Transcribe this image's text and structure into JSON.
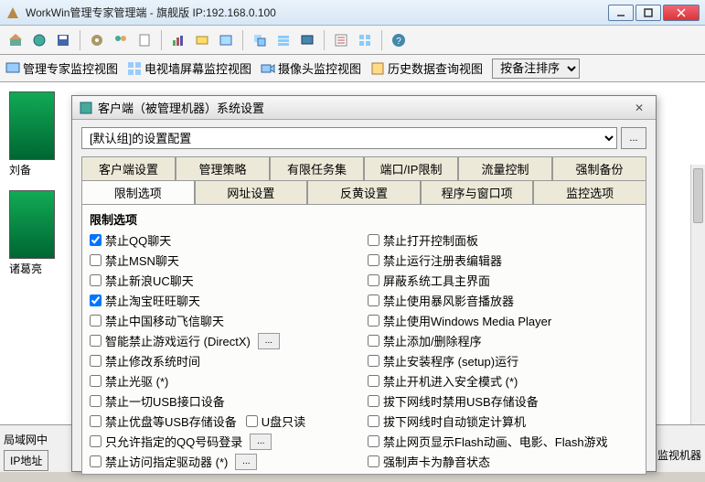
{
  "titlebar": {
    "app_title": "WorkWin管理专家管理端 - 旗舰版 IP:192.168.0.100"
  },
  "viewtabs": {
    "items": [
      "管理专家监控视图",
      "电视墙屏幕监控视图",
      "摄像头监控视图",
      "历史数据查询视图"
    ],
    "sort_label": "按备注排序"
  },
  "thumbs": [
    {
      "label": "刘备"
    },
    {
      "label": "诸葛亮"
    }
  ],
  "bottom": {
    "line1": "局域网中",
    "btn1": "IP地址",
    "right_label": "监视机器"
  },
  "dialog": {
    "title": "客户端（被管理机器）系统设置",
    "combo_value": "[默认组]的设置配置",
    "browse": "...",
    "tabs_row1": [
      "客户端设置",
      "管理策略",
      "有限任务集",
      "端口/IP限制",
      "流量控制",
      "强制备份"
    ],
    "tabs_row2": [
      "限制选项",
      "网址设置",
      "反黄设置",
      "程序与窗口项",
      "监控选项"
    ],
    "active_tab": "限制选项",
    "panel_title": "限制选项",
    "left_col": [
      {
        "label": "禁止QQ聊天",
        "checked": true
      },
      {
        "label": "禁止MSN聊天",
        "checked": false
      },
      {
        "label": "禁止新浪UC聊天",
        "checked": false
      },
      {
        "label": "禁止淘宝旺旺聊天",
        "checked": true
      },
      {
        "label": "禁止中国移动飞信聊天",
        "checked": false
      },
      {
        "label": "智能禁止游戏运行 (DirectX)",
        "checked": false,
        "aux": true
      },
      {
        "label": "禁止修改系统时间",
        "checked": false
      },
      {
        "label": "禁止光驱 (*)",
        "checked": false
      },
      {
        "label": "禁止一切USB接口设备",
        "checked": false
      },
      {
        "label": "禁止优盘等USB存储设备",
        "checked": false,
        "extra_label": "U盘只读",
        "extra_checked": false
      },
      {
        "label": "只允许指定的QQ号码登录",
        "checked": false,
        "aux": true
      },
      {
        "label": "禁止访问指定驱动器 (*)",
        "checked": false,
        "aux": true
      }
    ],
    "right_col": [
      {
        "label": "禁止打开控制面板",
        "checked": false
      },
      {
        "label": "禁止运行注册表编辑器",
        "checked": false
      },
      {
        "label": "屏蔽系统工具主界面",
        "checked": false
      },
      {
        "label": "禁止使用暴风影音播放器",
        "checked": false
      },
      {
        "label": "禁止使用Windows Media Player",
        "checked": false
      },
      {
        "label": "禁止添加/删除程序",
        "checked": false
      },
      {
        "label": "禁止安装程序 (setup)运行",
        "checked": false
      },
      {
        "label": "禁止开机进入安全模式 (*)",
        "checked": false
      },
      {
        "label": "拔下网线时禁用USB存储设备",
        "checked": false
      },
      {
        "label": "拔下网线时自动锁定计算机",
        "checked": false
      },
      {
        "label": "禁止网页显示Flash动画、电影、Flash游戏",
        "checked": false
      },
      {
        "label": "强制声卡为静音状态",
        "checked": false
      }
    ]
  }
}
